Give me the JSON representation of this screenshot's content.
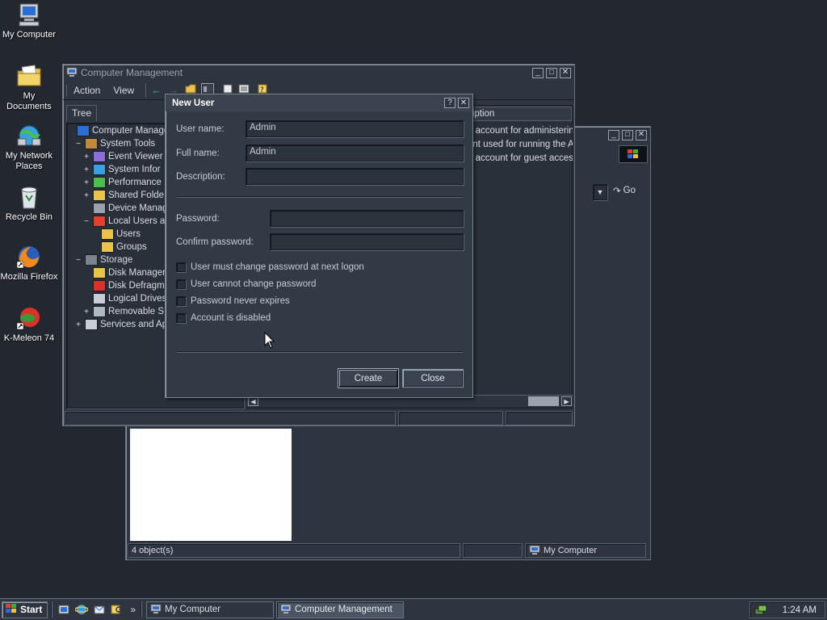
{
  "desktop": {
    "icons": [
      {
        "label": "My Computer",
        "icon": "computer-icon"
      },
      {
        "label": "My Documents",
        "icon": "folder-icon"
      },
      {
        "label": "My Network Places",
        "icon": "network-icon"
      },
      {
        "label": "Recycle Bin",
        "icon": "recycle-bin-icon"
      },
      {
        "label": "Mozilla Firefox",
        "icon": "firefox-icon"
      },
      {
        "label": "K-Meleon 74",
        "icon": "k-meleon-icon"
      }
    ]
  },
  "explorer": {
    "go_label": "Go",
    "status_count": "4 object(s)",
    "status_location": "My Computer"
  },
  "computer_management": {
    "title": "Computer Management",
    "menu": {
      "action": "Action",
      "view": "View"
    },
    "tree_tab": "Tree",
    "description_header": "ription",
    "descriptions": [
      "n account for administerin",
      "unt used for running the A",
      "n account for guest acces"
    ],
    "tree": [
      {
        "label": "Computer Manageme",
        "exp": "",
        "icon": "computer-icon"
      },
      {
        "label": "System Tools",
        "exp": "−",
        "icon": "tools-icon"
      },
      {
        "label": "Event Viewer",
        "exp": "+",
        "icon": "event-viewer-icon"
      },
      {
        "label": "System Infor",
        "exp": "+",
        "icon": "system-info-icon"
      },
      {
        "label": "Performance",
        "exp": "+",
        "icon": "performance-icon"
      },
      {
        "label": "Shared Folde",
        "exp": "+",
        "icon": "shared-folder-icon"
      },
      {
        "label": "Device Manag",
        "exp": "",
        "icon": "device-manager-icon"
      },
      {
        "label": "Local Users a",
        "exp": "−",
        "icon": "users-icon"
      },
      {
        "label": "Users",
        "exp": "",
        "icon": "folder-icon"
      },
      {
        "label": "Groups",
        "exp": "",
        "icon": "folder-icon"
      },
      {
        "label": "Storage",
        "exp": "−",
        "icon": "storage-icon"
      },
      {
        "label": "Disk Manager",
        "exp": "",
        "icon": "disk-icon"
      },
      {
        "label": "Disk Defragm",
        "exp": "",
        "icon": "defrag-icon"
      },
      {
        "label": "Logical Drives",
        "exp": "",
        "icon": "drive-icon"
      },
      {
        "label": "Removable S",
        "exp": "+",
        "icon": "removable-icon"
      },
      {
        "label": "Services and App",
        "exp": "+",
        "icon": "services-icon"
      }
    ]
  },
  "dialog": {
    "title": "New User",
    "help_button": "?",
    "username_label": "User name:",
    "username_value": "Admin",
    "fullname_label": "Full name:",
    "fullname_value": "Admin",
    "description_label": "Description:",
    "description_value": "",
    "password_label": "Password:",
    "confirm_label": "Confirm password:",
    "checkboxes": [
      "User must change password at next logon",
      "User cannot change password",
      "Password never expires",
      "Account is disabled"
    ],
    "create_label": "Create",
    "close_label": "Close"
  },
  "taskbar": {
    "start_label": "Start",
    "quicklaunch_more": "»",
    "tasks": [
      "My Computer",
      "Computer Management"
    ],
    "clock": "1:24 AM"
  }
}
